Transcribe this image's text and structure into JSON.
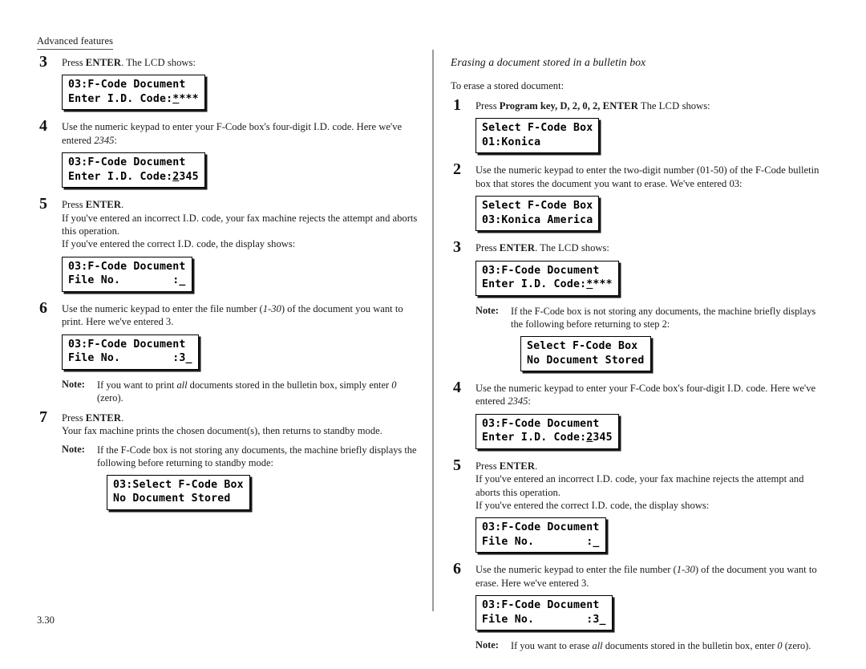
{
  "page": {
    "running_head": "Advanced features",
    "folio": "3.30"
  },
  "left_column": {
    "steps": [
      {
        "num": "3",
        "text_before": "Press ",
        "key": "ENTER",
        "text_after": ". The ",
        "sc2": "LCD",
        "text_end": " shows:",
        "lcd": {
          "line1": "03:F-Code Document",
          "line2_a": "Enter I.D. Code:",
          "line2_cursor": "*",
          "line2_b": "***"
        }
      },
      {
        "num": "4",
        "line1_a": "Use the numeric keypad to enter your F-Code box's four-digit ",
        "line1_sc": "I.D.",
        "line1_b": " code.",
        "line2_a": "Here we've entered ",
        "line2_ital": "2345",
        "line2_b": ":",
        "lcd": {
          "line1": "03:F-Code Document",
          "line2_a": "Enter I.D. Code:",
          "line2_cursor": "2",
          "line2_b": "345"
        }
      },
      {
        "num": "5",
        "p1_a": "Press ",
        "p1_key": "ENTER",
        "p1_b": ".",
        "p2_a": "If you've entered an incorrect ",
        "p2_sc": "I.D.",
        "p2_b": " code, your fax machine rejects the attempt and aborts this operation.",
        "p3_a": "If you've entered the correct ",
        "p3_sc": "I.D.",
        "p3_b": " code, the display shows:",
        "lcd": {
          "line1": "03:F-Code Document",
          "line2": "File No.        :_"
        }
      },
      {
        "num": "6",
        "line1_a": "Use the numeric keypad to enter the file number (",
        "line1_ital": "1-30",
        "line1_b": ") of the document you want to print. Here we've entered 3.",
        "lcd": {
          "line1": "03:F-Code Document",
          "line2": "File No.        :3_"
        },
        "note": {
          "label": "Note:",
          "text_a": "If you want to print ",
          "text_ital": "all",
          "text_b": " documents stored in the bulletin box, simply enter ",
          "text_ital2": "0",
          "text_c": " (zero)."
        }
      },
      {
        "num": "7",
        "p1_a": "Press ",
        "p1_key": "ENTER",
        "p1_b": ".",
        "p2": "Your fax machine prints the chosen document(s), then returns to standby mode.",
        "note": {
          "label": "Note:",
          "text": "If the F-Code box is not storing any documents, the machine briefly displays the following before returning to standby mode:",
          "lcd": {
            "line1": "03:Select F-Code Box",
            "line2": "No Document Stored"
          }
        }
      }
    ]
  },
  "right_column": {
    "heading": "Erasing a document stored in a bulletin box",
    "lead_in": "To erase a stored document:",
    "steps": [
      {
        "num": "1",
        "text_a": "Press ",
        "bold_keys": "Program key, D, 2, 0, 2,",
        "key": "ENTER",
        "text_b": " The ",
        "sc2": "LCD",
        "text_c": " shows:",
        "lcd": {
          "line1": "Select F-Code Box",
          "line2": "01:Konica"
        }
      },
      {
        "num": "2",
        "text": "Use the numeric keypad to enter the two-digit number (01-50) of the F-Code bulletin box that stores the document you want to erase. We've entered 03:",
        "lcd": {
          "line1": "Select F-Code Box",
          "line2": "03:Konica America"
        }
      },
      {
        "num": "3",
        "text_a": "Press ",
        "key": "ENTER",
        "text_b": ". The ",
        "sc2": "LCD",
        "text_c": " shows:",
        "lcd": {
          "line1": "03:F-Code Document",
          "line2_a": "Enter I.D. Code:",
          "line2_cursor": "*",
          "line2_b": "***"
        },
        "note": {
          "label": "Note:",
          "text": "If the F-Code box is not storing any documents, the machine briefly displays the following before returning to step 2:",
          "lcd": {
            "line1": "Select F-Code Box",
            "line2": "No Document Stored"
          }
        }
      },
      {
        "num": "4",
        "line1_a": "Use the numeric keypad to enter your F-Code box's four-digit ",
        "line1_sc": "I.D.",
        "line1_b": " code.",
        "line2_a": "Here we've entered ",
        "line2_ital": "2345",
        "line2_b": ":",
        "lcd": {
          "line1": "03:F-Code Document",
          "line2_a": "Enter I.D. Code:",
          "line2_cursor": "2",
          "line2_b": "345"
        }
      },
      {
        "num": "5",
        "p1_a": "Press ",
        "p1_key": "ENTER",
        "p1_b": ".",
        "p2_a": "If you've entered an incorrect ",
        "p2_sc": "I.D.",
        "p2_b": " code, your fax machine rejects the attempt and aborts this operation.",
        "p3_a": "If you've entered the correct ",
        "p3_sc": "I.D.",
        "p3_b": " code, the display shows:",
        "lcd": {
          "line1": "03:F-Code Document",
          "line2": "File No.        :_"
        }
      },
      {
        "num": "6",
        "line1_a": "Use the numeric keypad to enter the file number (",
        "line1_ital": "1-30",
        "line1_b": ") of the document you want to erase. Here we've entered 3.",
        "lcd": {
          "line1": "03:F-Code Document",
          "line2": "File No.        :3_"
        },
        "note": {
          "label": "Note:",
          "text_a": "If you want to erase ",
          "text_ital": "all",
          "text_b": " documents stored in the bulletin box, enter ",
          "text_ital2": "0",
          "text_c": " (zero)."
        }
      }
    ]
  }
}
